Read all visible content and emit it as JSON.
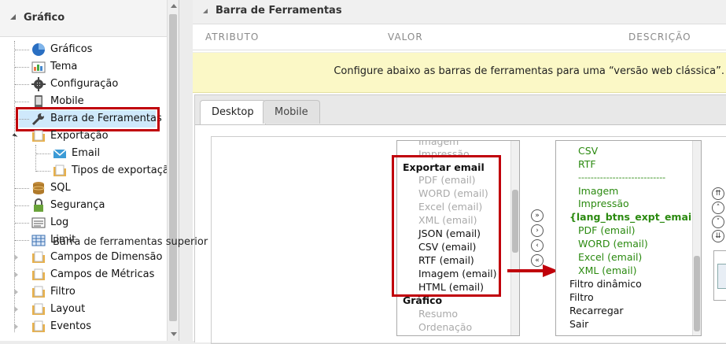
{
  "tree": {
    "title": "Gráfico",
    "items": [
      {
        "label": "Gráficos",
        "icon": "pie-chart-icon"
      },
      {
        "label": "Tema",
        "icon": "theme-icon"
      },
      {
        "label": "Configuração",
        "icon": "gear-icon"
      },
      {
        "label": "Mobile",
        "icon": "mobile-icon"
      },
      {
        "label": "Barra de Ferramentas",
        "icon": "wrench-icon"
      },
      {
        "label": "Exportação",
        "icon": "folder-icon"
      },
      {
        "label": "Email",
        "icon": "email-icon"
      },
      {
        "label": "Tipos de exportação",
        "icon": "folder-icon"
      },
      {
        "label": "SQL",
        "icon": "database-icon"
      },
      {
        "label": "Segurança",
        "icon": "lock-icon"
      },
      {
        "label": "Log",
        "icon": "log-icon"
      },
      {
        "label": "Limit",
        "icon": "table-icon"
      },
      {
        "label": "Campos de Dimensão",
        "icon": "folder-icon"
      },
      {
        "label": "Campos de Métricas",
        "icon": "folder-icon"
      },
      {
        "label": "Filtro",
        "icon": "folder-icon"
      },
      {
        "label": "Layout",
        "icon": "folder-icon"
      },
      {
        "label": "Eventos",
        "icon": "folder-icon"
      }
    ]
  },
  "main": {
    "title": "Barra de Ferramentas",
    "columns": [
      "ATRIBUTO",
      "VALOR",
      "DESCRIÇÃO"
    ],
    "info": "Configure abaixo as barras de ferramentas para uma “versão web clássica”.",
    "tabs": [
      "Desktop",
      "Mobile"
    ],
    "field_label": "Barra de ferramentas superior"
  },
  "list_left": [
    {
      "text": "Imagem",
      "style": "grey"
    },
    {
      "text": "Impressão",
      "style": "grey"
    },
    {
      "text": "Exportar email",
      "style": "bold"
    },
    {
      "text": "PDF (email)",
      "style": "grey"
    },
    {
      "text": "WORD (email)",
      "style": "grey"
    },
    {
      "text": "Excel (email)",
      "style": "grey"
    },
    {
      "text": "XML (email)",
      "style": "grey"
    },
    {
      "text": "JSON (email)",
      "style": "black"
    },
    {
      "text": "CSV (email)",
      "style": "black"
    },
    {
      "text": "RTF (email)",
      "style": "black"
    },
    {
      "text": "Imagem (email)",
      "style": "black"
    },
    {
      "text": "HTML (email)",
      "style": "black"
    },
    {
      "text": "Gráfico",
      "style": "bold"
    },
    {
      "text": "Resumo",
      "style": "grey"
    },
    {
      "text": "Ordenação",
      "style": "grey"
    }
  ],
  "list_right": [
    {
      "text": "CSV",
      "style": "green"
    },
    {
      "text": "RTF",
      "style": "green"
    },
    {
      "text": "----------------------------",
      "style": "green"
    },
    {
      "text": "Imagem",
      "style": "green"
    },
    {
      "text": "Impressão",
      "style": "green"
    },
    {
      "text": "{lang_btns_expt_email}",
      "style": "greenb"
    },
    {
      "text": "PDF (email)",
      "style": "green"
    },
    {
      "text": "WORD (email)",
      "style": "green"
    },
    {
      "text": "Excel (email)",
      "style": "green"
    },
    {
      "text": "XML (email)",
      "style": "green"
    },
    {
      "text": "Filtro dinâmico",
      "style": "black"
    },
    {
      "text": "Filtro",
      "style": "black"
    },
    {
      "text": "Recarregar",
      "style": "black"
    },
    {
      "text": "Sair",
      "style": "black"
    }
  ],
  "transfer_buttons": [
    "»",
    "›",
    "‹",
    "«"
  ],
  "order_buttons": [
    "⇈",
    "˄",
    "˅",
    "⇊"
  ],
  "colors": {
    "highlight": "#c0000a",
    "selected_bg": "#cfe9fb",
    "info_bg": "#fbf8c6",
    "green": "#2b8a10"
  }
}
